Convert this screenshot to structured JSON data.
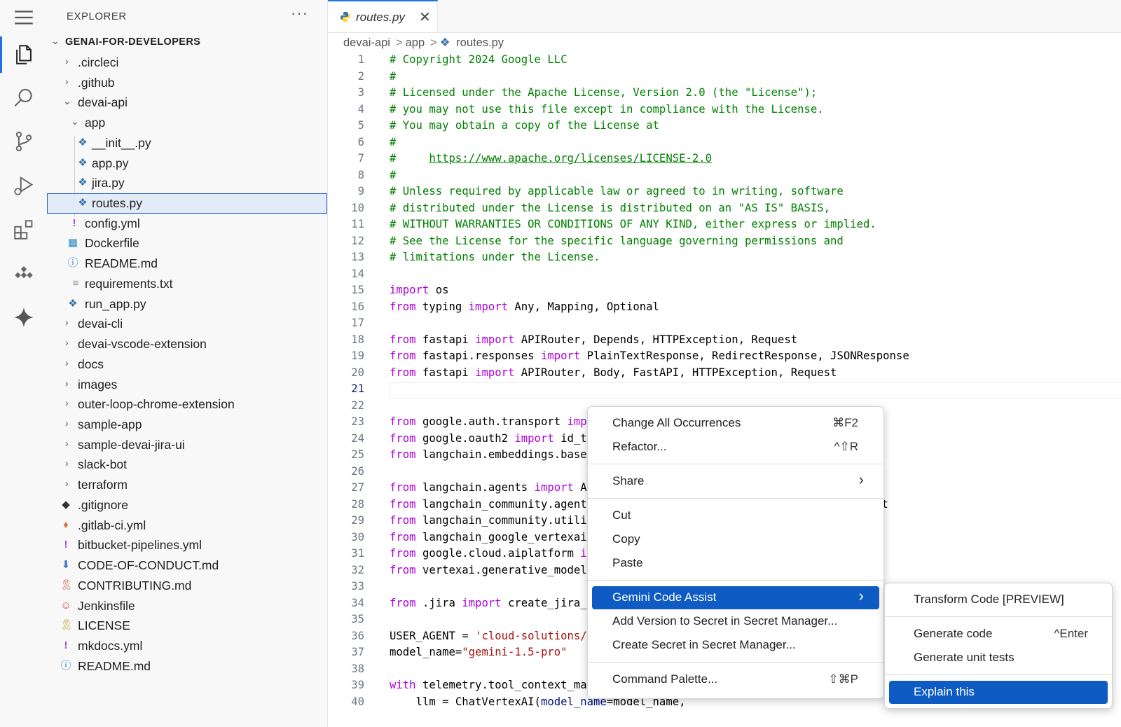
{
  "explorer": {
    "title": "EXPLORER",
    "more": "···",
    "root": "GENAI-FOR-DEVELOPERS",
    "items": [
      {
        "label": ".circleci"
      },
      {
        "label": ".github"
      },
      {
        "label": "devai-api"
      },
      {
        "label": "app"
      },
      {
        "label": "__init__.py"
      },
      {
        "label": "app.py"
      },
      {
        "label": "jira.py"
      },
      {
        "label": "routes.py"
      },
      {
        "label": "config.yml"
      },
      {
        "label": "Dockerfile"
      },
      {
        "label": "README.md"
      },
      {
        "label": "requirements.txt"
      },
      {
        "label": "run_app.py"
      },
      {
        "label": "devai-cli"
      },
      {
        "label": "devai-vscode-extension"
      },
      {
        "label": "docs"
      },
      {
        "label": "images"
      },
      {
        "label": "outer-loop-chrome-extension"
      },
      {
        "label": "sample-app"
      },
      {
        "label": "sample-devai-jira-ui"
      },
      {
        "label": "slack-bot"
      },
      {
        "label": "terraform"
      },
      {
        "label": ".gitignore"
      },
      {
        "label": ".gitlab-ci.yml"
      },
      {
        "label": "bitbucket-pipelines.yml"
      },
      {
        "label": "CODE-OF-CONDUCT.md"
      },
      {
        "label": "CONTRIBUTING.md"
      },
      {
        "label": "Jenkinsfile"
      },
      {
        "label": "LICENSE"
      },
      {
        "label": "mkdocs.yml"
      },
      {
        "label": "README.md"
      }
    ]
  },
  "tab": {
    "label": "routes.py",
    "close": "✕"
  },
  "breadcrumb": {
    "parts": [
      "devai-api",
      "app",
      "routes.py"
    ],
    "sep": ">"
  },
  "code": {
    "current_line": 21,
    "lines": [
      {
        "n": "1"
      },
      {
        "n": "2"
      },
      {
        "n": "3"
      },
      {
        "n": "4"
      },
      {
        "n": "5"
      },
      {
        "n": "6"
      },
      {
        "n": "7"
      },
      {
        "n": "8"
      },
      {
        "n": "9"
      },
      {
        "n": "10"
      },
      {
        "n": "11"
      },
      {
        "n": "12"
      },
      {
        "n": "13"
      },
      {
        "n": "14"
      },
      {
        "n": "15"
      },
      {
        "n": "16"
      },
      {
        "n": "17"
      },
      {
        "n": "18"
      },
      {
        "n": "19"
      },
      {
        "n": "20"
      },
      {
        "n": "21"
      },
      {
        "n": "22"
      },
      {
        "n": "23"
      },
      {
        "n": "24"
      },
      {
        "n": "25"
      },
      {
        "n": "26"
      },
      {
        "n": "27"
      },
      {
        "n": "28"
      },
      {
        "n": "29"
      },
      {
        "n": "30"
      },
      {
        "n": "31"
      },
      {
        "n": "32"
      },
      {
        "n": "33"
      },
      {
        "n": "34"
      },
      {
        "n": "35"
      },
      {
        "n": "36"
      },
      {
        "n": "37"
      },
      {
        "n": "38"
      },
      {
        "n": "39"
      },
      {
        "n": "40"
      }
    ],
    "text": {
      "l1": "# Copyright 2024 Google LLC",
      "l2": "#",
      "l3": "# Licensed under the Apache License, Version 2.0 (the \"License\");",
      "l4": "# you may not use this file except in compliance with the License.",
      "l5": "# You may obtain a copy of the License at",
      "l6": "#",
      "l7a": "#     ",
      "l7b": "https://www.apache.org/licenses/LICENSE-2.0",
      "l8": "#",
      "l9": "# Unless required by applicable law or agreed to in writing, software",
      "l10": "# distributed under the License is distributed on an \"AS IS\" BASIS,",
      "l11": "# WITHOUT WARRANTIES OR CONDITIONS OF ANY KIND, either express or implied.",
      "l12": "# See the License for the specific language governing permissions and",
      "l13": "# limitations under the License.",
      "kw_import": "import",
      "kw_from": "from",
      "l15b": " os",
      "l16b": " typing ",
      "l16d": " Any, Mapping, Optional",
      "l18b": " fastapi ",
      "l18d": " APIRouter, Depends, HTTPException, Request",
      "l19b": " fastapi.responses ",
      "l19d": " PlainTextResponse, RedirectResponse, JSONResponse",
      "l20b": " fastapi ",
      "l20d": " APIRouter, Body, FastAPI, HTTPException, Request",
      "l23b": " google.auth.transport ",
      "l23c": "imp",
      "l24b": " google.oauth2 ",
      "l24d": " id_t",
      "l25b": " langchain.embeddings.base",
      "l27b": " langchain.agents ",
      "l27d": " A",
      "l28b": " langchain_community.agent",
      "l28tail": "it",
      "l29b": " langchain_community.utili",
      "l30b": " langchain_google_vertexai",
      "l31b": " google.cloud.aiplatform ",
      "l31c": "i",
      "l32b": " vertexai.generative_model",
      "l34b": " .jira ",
      "l34d": " create_jira_",
      "l36a": "USER_AGENT = ",
      "l36b": "'cloud-solutions/",
      "l37a": "model_name=",
      "l37b": "\"gemini-1.5-pro\"",
      "l39a": "with",
      "l39b": " telemetry.tool_context_manager(USER_AGENT):",
      "l40a": "    llm = ChatVertexAI(",
      "l40b": "model_name",
      "l40c": "=model_name,"
    }
  },
  "context_menu": {
    "change_all": {
      "label": "Change All Occurrences",
      "key": "⌘F2"
    },
    "refactor": {
      "label": "Refactor...",
      "key": "^⇧R"
    },
    "share": {
      "label": "Share",
      "arrow": "›"
    },
    "cut": {
      "label": "Cut"
    },
    "copy": {
      "label": "Copy"
    },
    "paste": {
      "label": "Paste"
    },
    "gemini": {
      "label": "Gemini Code Assist",
      "arrow": "›"
    },
    "add_version": {
      "label": "Add Version to Secret in Secret Manager..."
    },
    "create_secret": {
      "label": "Create Secret in Secret Manager..."
    },
    "command_palette": {
      "label": "Command Palette...",
      "key": "⇧⌘P"
    }
  },
  "submenu": {
    "transform": {
      "label": "Transform Code [PREVIEW]"
    },
    "generate": {
      "label": "Generate code",
      "key": "^Enter"
    },
    "unit_tests": {
      "label": "Generate unit tests"
    },
    "explain": {
      "label": "Explain this"
    }
  },
  "colors": {
    "accent": "#0f5bc4",
    "comment": "#008000",
    "keyword": "#af00db",
    "string": "#a31515"
  }
}
